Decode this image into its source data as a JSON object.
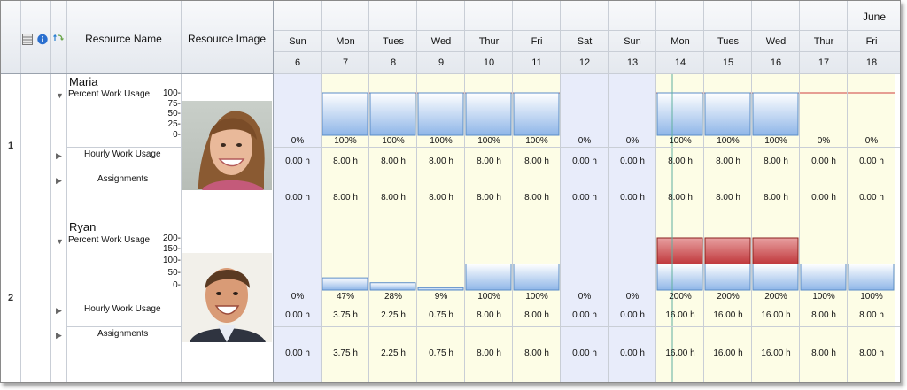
{
  "header": {
    "resource_name": "Resource Name",
    "resource_image": "Resource Image",
    "month": "June",
    "days": [
      {
        "name": "Sun",
        "date": "6",
        "weekend": true
      },
      {
        "name": "Mon",
        "date": "7",
        "weekend": false
      },
      {
        "name": "Tues",
        "date": "8",
        "weekend": false
      },
      {
        "name": "Wed",
        "date": "9",
        "weekend": false
      },
      {
        "name": "Thur",
        "date": "10",
        "weekend": false
      },
      {
        "name": "Fri",
        "date": "11",
        "weekend": false
      },
      {
        "name": "Sat",
        "date": "12",
        "weekend": true
      },
      {
        "name": "Sun",
        "date": "13",
        "weekend": true
      },
      {
        "name": "Mon",
        "date": "14",
        "weekend": false
      },
      {
        "name": "Tues",
        "date": "15",
        "weekend": false
      },
      {
        "name": "Wed",
        "date": "16",
        "weekend": false
      },
      {
        "name": "Thur",
        "date": "17",
        "weekend": false
      },
      {
        "name": "Fri",
        "date": "18",
        "weekend": false
      }
    ]
  },
  "labels": {
    "percent_work_usage": "Percent Work Usage",
    "hourly_work_usage": "Hourly Work Usage",
    "assignments": "Assignments"
  },
  "colors": {
    "weekday_bg": "#fdfde6",
    "weekend_bg": "#e8ecfa",
    "bar_blue": "#8fb6e8",
    "bar_red": "#c0383c",
    "capacity_line": "#d04040",
    "today_line": "#5fb0a0"
  },
  "resources": [
    {
      "row_number": "1",
      "name": "Maria",
      "yticks": [
        "100-",
        "75-",
        "50-",
        "25-",
        "0-"
      ],
      "ymax": 100,
      "photo": "woman-avatar",
      "percent": [
        0,
        100,
        100,
        100,
        100,
        100,
        0,
        0,
        100,
        100,
        100,
        0,
        0
      ],
      "percent_labels": [
        "0%",
        "100%",
        "100%",
        "100%",
        "100%",
        "100%",
        "0%",
        "0%",
        "100%",
        "100%",
        "100%",
        "0%",
        "0%"
      ],
      "hourly": [
        "0.00 h",
        "8.00 h",
        "8.00 h",
        "8.00 h",
        "8.00 h",
        "8.00 h",
        "0.00 h",
        "0.00 h",
        "8.00 h",
        "8.00 h",
        "8.00 h",
        "0.00 h",
        "0.00 h"
      ],
      "assignments": [
        "0.00 h",
        "8.00 h",
        "8.00 h",
        "8.00 h",
        "8.00 h",
        "8.00 h",
        "0.00 h",
        "0.00 h",
        "8.00 h",
        "8.00 h",
        "8.00 h",
        "0.00 h",
        "0.00 h"
      ]
    },
    {
      "row_number": "2",
      "name": "Ryan",
      "yticks": [
        "200-",
        "150-",
        "100-",
        "50-",
        "0-"
      ],
      "ymax": 200,
      "photo": "man-avatar",
      "percent": [
        0,
        47,
        28,
        9,
        100,
        100,
        0,
        0,
        200,
        200,
        200,
        100,
        100
      ],
      "percent_labels": [
        "0%",
        "47%",
        "28%",
        "9%",
        "100%",
        "100%",
        "0%",
        "0%",
        "200%",
        "200%",
        "200%",
        "100%",
        "100%"
      ],
      "hourly": [
        "0.00 h",
        "3.75 h",
        "2.25 h",
        "0.75 h",
        "8.00 h",
        "8.00 h",
        "0.00 h",
        "0.00 h",
        "16.00 h",
        "16.00 h",
        "16.00 h",
        "8.00 h",
        "8.00 h"
      ],
      "assignments": [
        "0.00 h",
        "3.75 h",
        "2.25 h",
        "0.75 h",
        "8.00 h",
        "8.00 h",
        "0.00 h",
        "0.00 h",
        "16.00 h",
        "16.00 h",
        "16.00 h",
        "8.00 h",
        "8.00 h"
      ]
    }
  ],
  "icons": [
    "grid-icon",
    "info-icon",
    "swap-icon",
    "expand-down-icon",
    "expand-right-icon"
  ]
}
